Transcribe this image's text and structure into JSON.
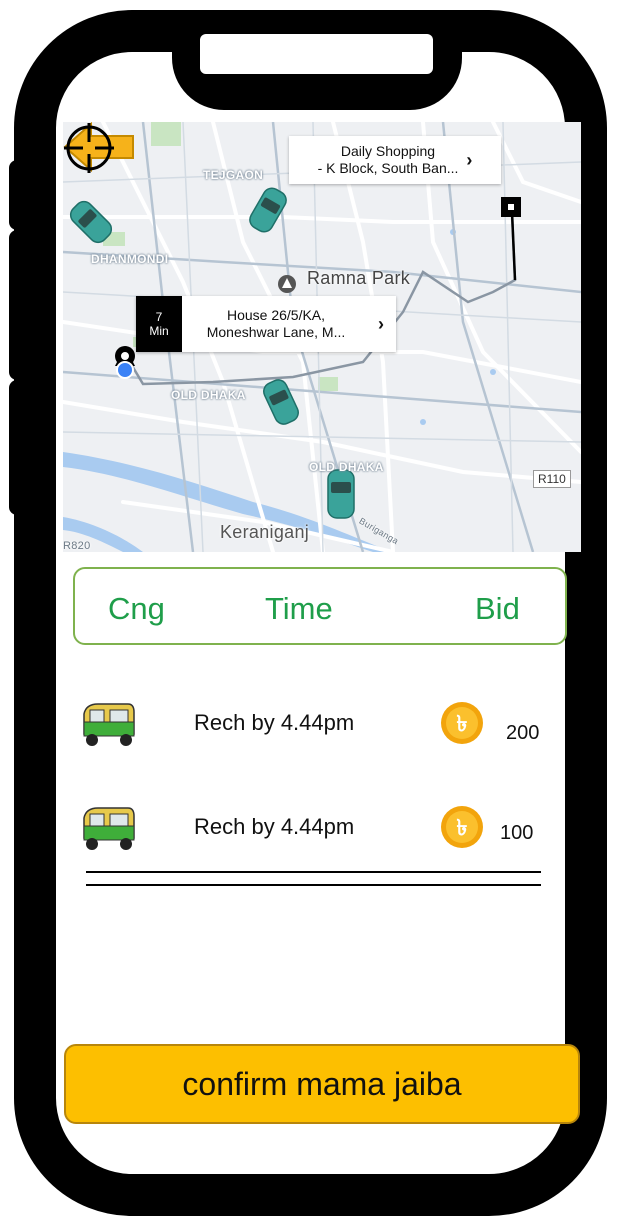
{
  "map": {
    "destination": {
      "line1": "Daily Shopping",
      "line2": "- K Block, South Ban..."
    },
    "pickup": {
      "eta_value": "7",
      "eta_unit": "Min",
      "line1": "House 26/5/KA,",
      "line2": "Moneshwar Lane, M..."
    },
    "labels": {
      "tejgaon": "TEJGAON",
      "dhanmondi": "DHANMONDI",
      "ramna_park": "Ramna Park",
      "old_dhaka_1": "OLD DHAKA",
      "old_dhaka_2": "OLD DHAKA",
      "keraniganj": "Keraniganj",
      "buriganga": "Buriganga",
      "road_badge": "R110",
      "corner": "R820"
    }
  },
  "header": {
    "col1": "Cng",
    "col2": "Time",
    "col3": "Bid"
  },
  "rides": [
    {
      "eta": "Rech by 4.44pm",
      "bid": "200"
    },
    {
      "eta": "Rech by 4.44pm",
      "bid": "100"
    }
  ],
  "confirm": {
    "label": "confirm mama jaiba"
  },
  "colors": {
    "accent_yellow": "#fdbf00",
    "header_green": "#1f9e4a",
    "border_green": "#7fb24d",
    "arrow_orange": "#f6b21a",
    "car_teal": "#3aa39a"
  },
  "icons": {
    "back": "back-arrow-icon",
    "locate": "crosshair-icon",
    "vehicle": "cng-rickshaw-icon",
    "coin": "taka-coin-icon",
    "chevron": "chevron-right-icon"
  }
}
